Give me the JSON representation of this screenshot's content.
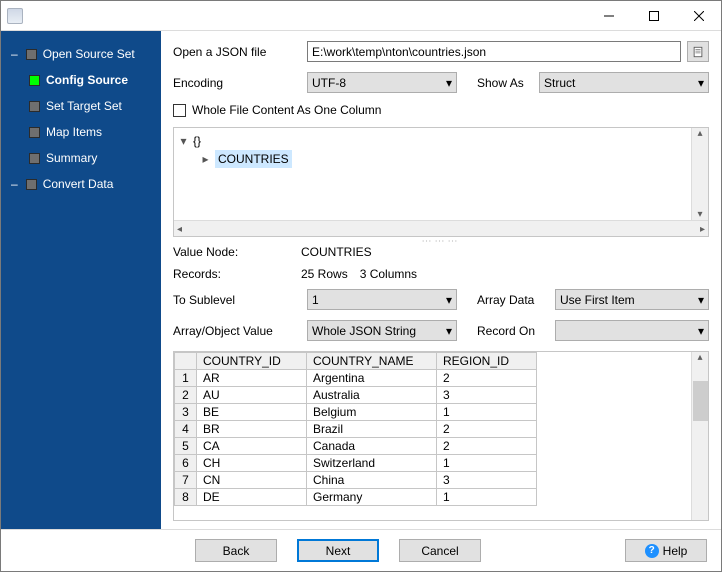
{
  "nav": {
    "items": [
      {
        "label": "Open Source Set",
        "sub": false
      },
      {
        "label": "Config Source",
        "sub": true,
        "active": true
      },
      {
        "label": "Set Target Set",
        "sub": true
      },
      {
        "label": "Map Items",
        "sub": true
      },
      {
        "label": "Summary",
        "sub": true
      },
      {
        "label": "Convert Data",
        "sub": false
      }
    ]
  },
  "form": {
    "open_label": "Open a JSON file",
    "path_value": "E:\\work\\temp\\nton\\countries.json",
    "encoding_label": "Encoding",
    "encoding_value": "UTF-8",
    "showas_label": "Show As",
    "showas_value": "Struct",
    "whole_file_label": "Whole File Content As One Column"
  },
  "tree": {
    "root": "{}",
    "child": "COUNTRIES"
  },
  "info": {
    "valuenode_label": "Value Node:",
    "valuenode_value": "COUNTRIES",
    "records_label": "Records:",
    "records_value_rows": "25 Rows",
    "records_value_cols": "3 Columns",
    "tosublevel_label": "To Sublevel",
    "tosublevel_value": "1",
    "arraydata_label": "Array Data",
    "arraydata_value": "Use First Item",
    "arrayobj_label": "Array/Object Value",
    "arrayobj_value": "Whole JSON String",
    "recordon_label": "Record On",
    "recordon_value": ""
  },
  "grid": {
    "columns": [
      "COUNTRY_ID",
      "COUNTRY_NAME",
      "REGION_ID"
    ],
    "rows": [
      [
        "AR",
        "Argentina",
        "2"
      ],
      [
        "AU",
        "Australia",
        "3"
      ],
      [
        "BE",
        "Belgium",
        "1"
      ],
      [
        "BR",
        "Brazil",
        "2"
      ],
      [
        "CA",
        "Canada",
        "2"
      ],
      [
        "CH",
        "Switzerland",
        "1"
      ],
      [
        "CN",
        "China",
        "3"
      ],
      [
        "DE",
        "Germany",
        "1"
      ]
    ]
  },
  "footer": {
    "back": "Back",
    "next": "Next",
    "cancel": "Cancel",
    "help": "Help"
  }
}
